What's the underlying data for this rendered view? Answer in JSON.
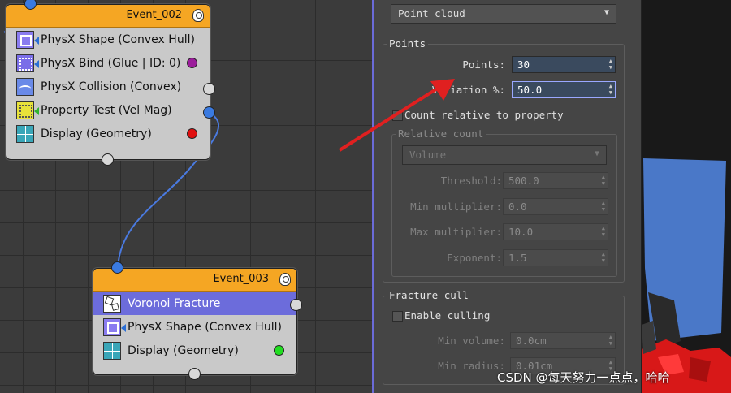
{
  "graph": {
    "event_002": {
      "title": "Event_002",
      "rows": [
        {
          "label": "PhysX Shape (Convex Hull)",
          "icon": "physx-shape-icon",
          "dot": ""
        },
        {
          "label": "PhysX Bind (Glue | ID: 0)",
          "icon": "physx-bind-icon",
          "dot": "#9b1d9b"
        },
        {
          "label": "PhysX Collision (Convex)",
          "icon": "physx-collision-icon",
          "dot": "#d8d8d8"
        },
        {
          "label": "Property Test (Vel Mag)",
          "icon": "property-test-icon",
          "dot": "#3a7ae0"
        },
        {
          "label": "Display (Geometry)",
          "icon": "display-geometry-icon",
          "dot": "#e01010"
        }
      ]
    },
    "event_003": {
      "title": "Event_003",
      "rows": [
        {
          "label": "Voronoi Fracture",
          "icon": "voronoi-fracture-icon",
          "dot": "",
          "selected": true
        },
        {
          "label": "PhysX Shape (Convex Hull)",
          "icon": "physx-shape-icon",
          "dot": ""
        },
        {
          "label": "Display (Geometry)",
          "icon": "display-geometry-icon",
          "dot": "#22dd22"
        }
      ]
    },
    "colors": {
      "wire": "#4a7ae0",
      "header": "#f5a623",
      "selected_row": "#6c6cdb",
      "annotation_arrow": "#e02020"
    }
  },
  "panel": {
    "source_dropdown": "Point cloud",
    "points_group": {
      "title": "Points",
      "points_label": "Points:",
      "points_value": "30",
      "variation_label": "Variation %:",
      "variation_value": "50.0",
      "count_relative_label": "Count relative to property",
      "relative_count": {
        "title": "Relative count",
        "dropdown": "Volume",
        "threshold_label": "Threshold:",
        "threshold_value": "500.0",
        "min_mult_label": "Min multiplier:",
        "min_mult_value": "0.0",
        "max_mult_label": "Max multiplier:",
        "max_mult_value": "10.0",
        "exponent_label": "Exponent:",
        "exponent_value": "1.5"
      }
    },
    "fracture_cull": {
      "title": "Fracture cull",
      "enable_label": "Enable culling",
      "min_volume_label": "Min volume:",
      "min_volume_value": "0.0cm",
      "min_radius_label": "Min radius:",
      "min_radius_value": "0.01cm"
    }
  },
  "watermark": "CSDN @每天努力一点点，哈哈"
}
